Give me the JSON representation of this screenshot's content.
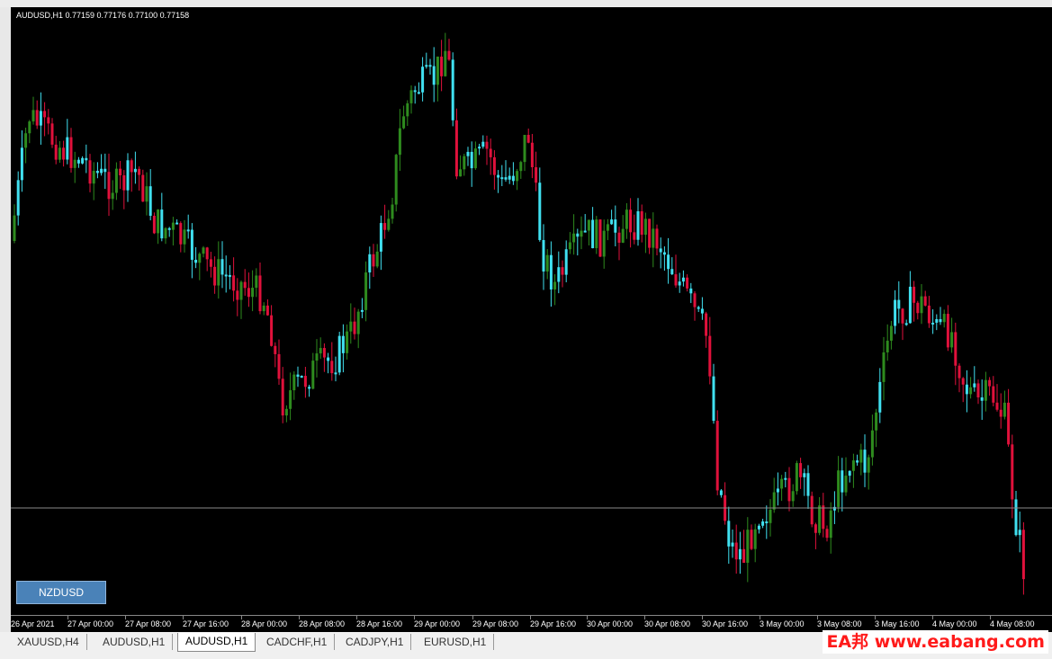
{
  "chart": {
    "info_text": "AUDUSD,H1  0.77159 0.77176 0.77100 0.77158",
    "symbol_button": "NZDUSD",
    "colors": {
      "bull": "#2e8b1e",
      "bear": "#e0113b",
      "doji_wick": "#40e0f0",
      "background": "#000000",
      "hline": "#8a8a8a"
    },
    "time_labels": [
      "26 Apr 2021",
      "27 Apr 00:00",
      "27 Apr 08:00",
      "27 Apr 16:00",
      "28 Apr 00:00",
      "28 Apr 08:00",
      "28 Apr 16:00",
      "29 Apr 00:00",
      "29 Apr 08:00",
      "29 Apr 16:00",
      "30 Apr 00:00",
      "30 Apr 08:00",
      "30 Apr 16:00",
      "3 May 00:00",
      "3 May 08:00",
      "3 May 16:00",
      "4 May 00:00",
      "4 May 08:00"
    ]
  },
  "tabs": [
    "XAUUSD,H4",
    "AUDUSD,H1",
    "AUDUSD,H1",
    "CADCHF,H1",
    "CADJPY,H1",
    "EURUSD,H1"
  ],
  "active_tab": 2,
  "watermark": "EA邦 www.eabang.com"
}
